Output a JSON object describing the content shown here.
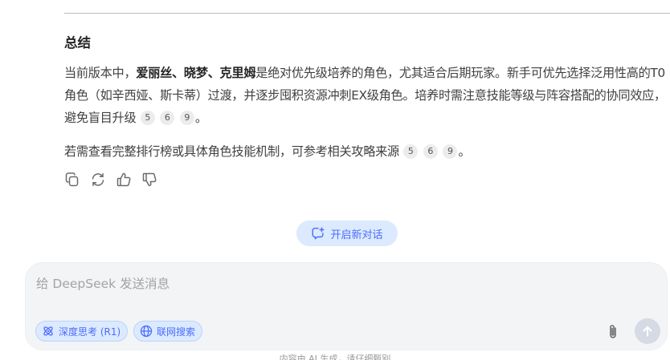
{
  "summary": {
    "heading": "总结",
    "para1": {
      "prefix": "当前版本中，",
      "bold": "爱丽丝、晓梦、克里姆",
      "middle": "是绝对优先级培养的角色，尤其适合后期玩家。新手可优先选择泛用性高的T0角色（如辛西娅、斯卡蒂）过渡，并逐步囤积资源冲刺EX级角色。培养时需注意技能等级与阵容搭配的协同效应，避免盲目升级",
      "citations": [
        "5",
        "6",
        "9"
      ],
      "suffix": "。"
    },
    "para2": {
      "text": "若需查看完整排行榜或具体角色技能机制，可参考相关攻略来源",
      "citations": [
        "5",
        "6",
        "9"
      ],
      "suffix": "。"
    }
  },
  "actions": [
    {
      "icon": "copy-icon"
    },
    {
      "icon": "regenerate-icon"
    },
    {
      "icon": "thumbs-up-icon"
    },
    {
      "icon": "thumbs-down-icon"
    }
  ],
  "new_chat": {
    "label": "开启新对话",
    "icon": "new-chat-icon"
  },
  "composer": {
    "placeholder": "给 DeepSeek 发送消息",
    "deep_think_label": "深度思考 (R1)",
    "web_search_label": "联网搜索",
    "attach_icon": "paperclip-icon",
    "send_icon": "arrow-up-icon"
  },
  "footer": {
    "note": "内容由 AI 生成，请仔细甄别"
  },
  "colors": {
    "accent": "#4d6bfe",
    "chip_bg": "#dbeafe",
    "send_disabled": "#d6dae4",
    "input_bg": "#f3f4f6"
  }
}
